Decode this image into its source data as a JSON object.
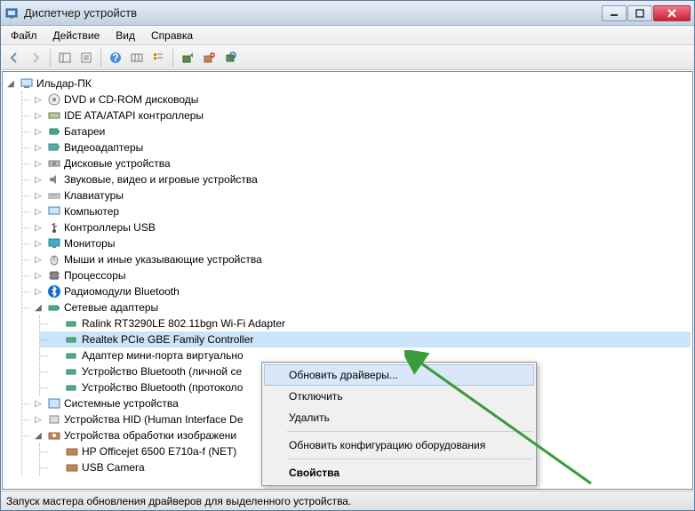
{
  "window": {
    "title": "Диспетчер устройств"
  },
  "menu": {
    "file": "Файл",
    "action": "Действие",
    "view": "Вид",
    "help": "Справка"
  },
  "tree": {
    "root": "Ильдар-ПК",
    "c1": "DVD и CD-ROM дисководы",
    "c2": "IDE ATA/ATAPI контроллеры",
    "c3": "Батареи",
    "c4": "Видеоадаптеры",
    "c5": "Дисковые устройства",
    "c6": "Звуковые, видео и игровые устройства",
    "c7": "Клавиатуры",
    "c8": "Компьютер",
    "c9": "Контроллеры USB",
    "c10": "Мониторы",
    "c11": "Мыши и иные указывающие устройства",
    "c12": "Процессоры",
    "c13": "Радиомодули Bluetooth",
    "c14": "Сетевые адаптеры",
    "c14_1": "Ralink RT3290LE 802.11bgn Wi-Fi Adapter",
    "c14_2": "Realtek PCIe GBE Family Controller",
    "c14_3": "Адаптер мини-порта виртуально",
    "c14_4": "Устройство Bluetooth (личной се",
    "c14_5": "Устройство Bluetooth (протоколо",
    "c15": "Системные устройства",
    "c16": "Устройства HID (Human Interface De",
    "c17": "Устройства обработки изображени",
    "c17_1": "HP Officejet 6500 E710a-f (NET)",
    "c17_2": "USB Camera"
  },
  "context": {
    "update": "Обновить драйверы...",
    "disable": "Отключить",
    "delete": "Удалить",
    "refresh": "Обновить конфигурацию оборудования",
    "props": "Свойства"
  },
  "status": "Запуск мастера обновления драйверов для выделенного устройства."
}
